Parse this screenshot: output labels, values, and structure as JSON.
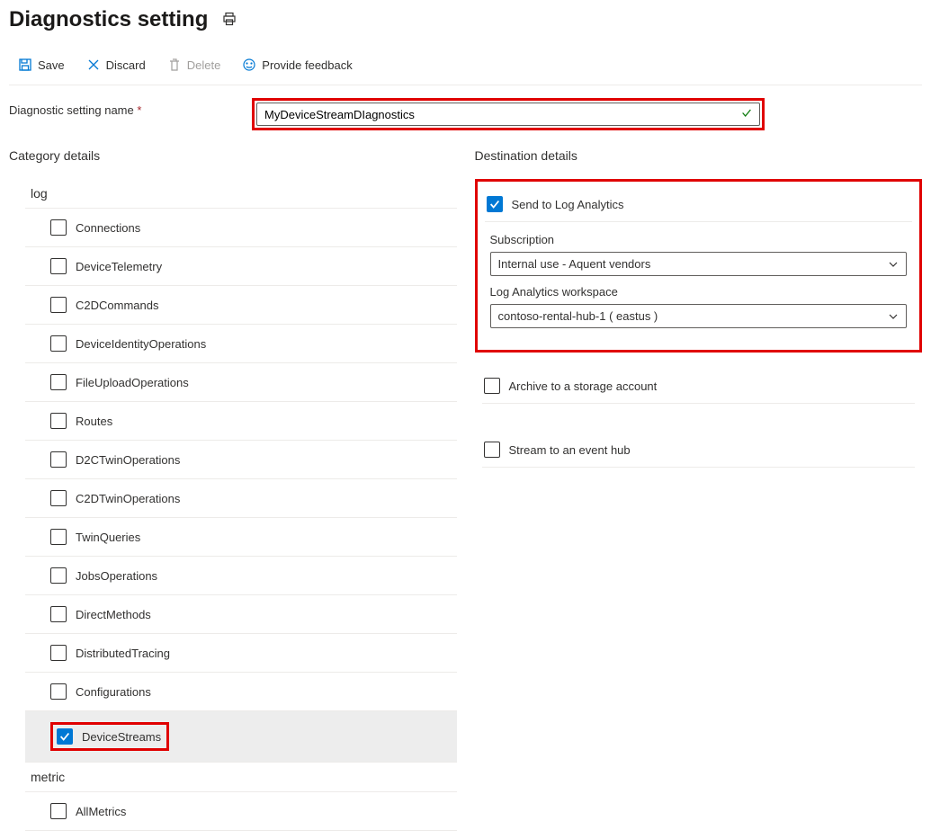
{
  "page": {
    "title": "Diagnostics setting"
  },
  "toolbar": {
    "save": "Save",
    "discard": "Discard",
    "delete": "Delete",
    "feedback": "Provide feedback"
  },
  "name": {
    "label": "Diagnostic setting name",
    "value": "MyDeviceStreamDIagnostics"
  },
  "category": {
    "title": "Category details",
    "groups": {
      "log": "log",
      "metric": "metric"
    },
    "log_items": [
      {
        "label": "Connections",
        "checked": false
      },
      {
        "label": "DeviceTelemetry",
        "checked": false
      },
      {
        "label": "C2DCommands",
        "checked": false
      },
      {
        "label": "DeviceIdentityOperations",
        "checked": false
      },
      {
        "label": "FileUploadOperations",
        "checked": false
      },
      {
        "label": "Routes",
        "checked": false
      },
      {
        "label": "D2CTwinOperations",
        "checked": false
      },
      {
        "label": "C2DTwinOperations",
        "checked": false
      },
      {
        "label": "TwinQueries",
        "checked": false
      },
      {
        "label": "JobsOperations",
        "checked": false
      },
      {
        "label": "DirectMethods",
        "checked": false
      },
      {
        "label": "DistributedTracing",
        "checked": false
      },
      {
        "label": "Configurations",
        "checked": false
      },
      {
        "label": "DeviceStreams",
        "checked": true
      }
    ],
    "metric_items": [
      {
        "label": "AllMetrics",
        "checked": false
      }
    ]
  },
  "destination": {
    "title": "Destination details",
    "log_analytics": {
      "label": "Send to Log Analytics",
      "checked": true,
      "subscription_label": "Subscription",
      "subscription_value": "Internal use - Aquent vendors",
      "workspace_label": "Log Analytics workspace",
      "workspace_value": "contoso-rental-hub-1 ( eastus )"
    },
    "storage": {
      "label": "Archive to a storage account",
      "checked": false
    },
    "eventhub": {
      "label": "Stream to an event hub",
      "checked": false
    }
  }
}
